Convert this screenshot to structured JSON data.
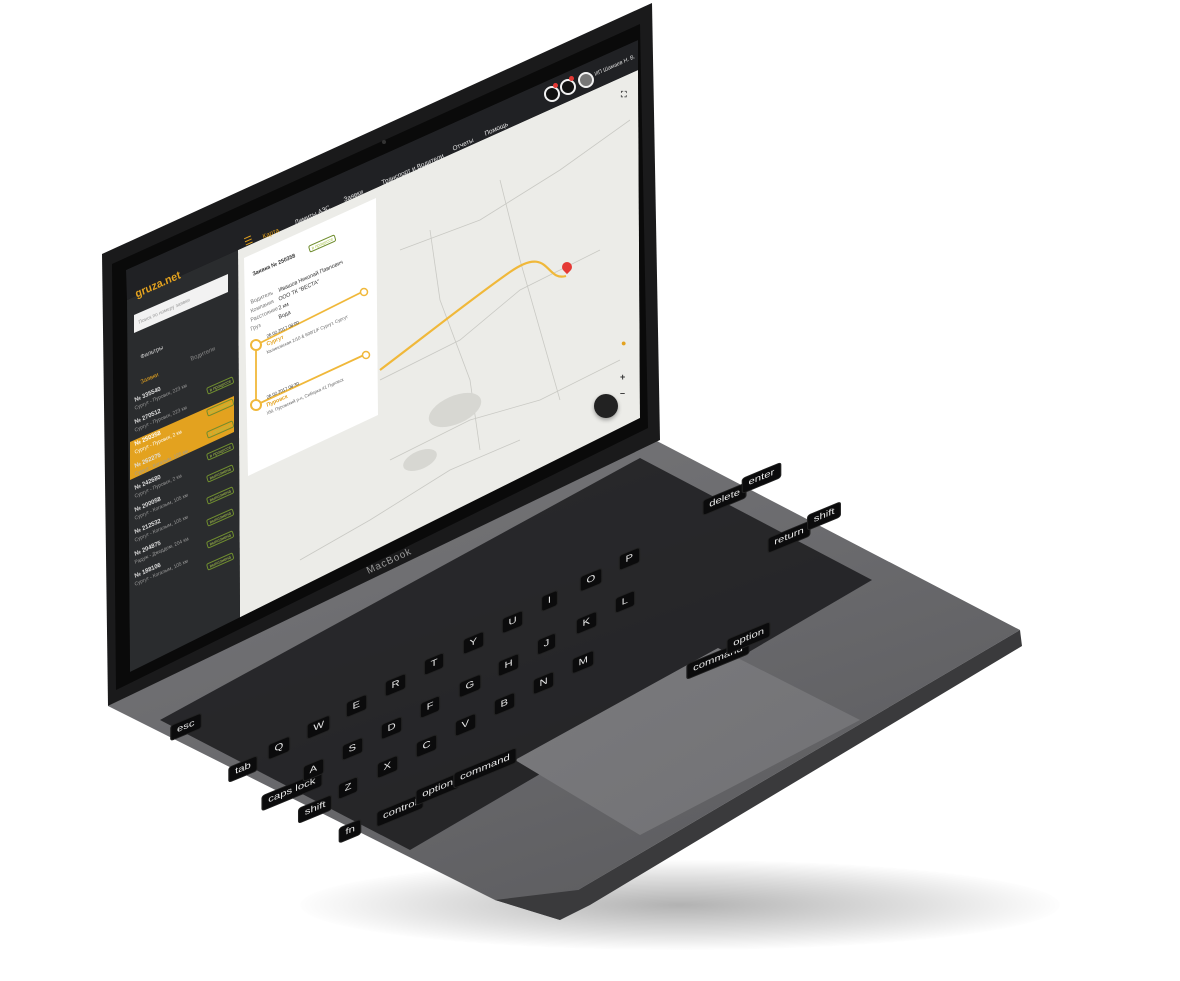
{
  "app": {
    "logo": "gruza.net",
    "device_brand": "MacBook"
  },
  "nav": {
    "items": [
      {
        "label": "Карта",
        "active": true
      },
      {
        "label": "Лимиты АЗС"
      },
      {
        "label": "Заявки"
      },
      {
        "label": "Транспорт и Водители"
      },
      {
        "label": "Отчеты"
      },
      {
        "label": "Помощь"
      }
    ],
    "user": "ИП Шамаев Н. В."
  },
  "sidebar": {
    "search_placeholder": "Поиск по номеру заявки",
    "filter_label": "Фильтры",
    "tabs": [
      {
        "label": "Заявки",
        "active": true
      },
      {
        "label": "Водители"
      }
    ],
    "orders": [
      {
        "number": "№ 335540",
        "route": "Сургут - Пуровск, 223 км",
        "status": "в процессе",
        "active": false
      },
      {
        "number": "№ 270512",
        "route": "Сургут - Пуровск, 223 км",
        "status": "выполнена",
        "active": false
      },
      {
        "number": "№ 250358",
        "route": "Сургут - Пуровск, 2 км",
        "status": "в процессе",
        "active": true
      },
      {
        "number": "№ 262275",
        "route": "Сургут - Когалым, 105 км",
        "status": "в процессе",
        "active": false
      },
      {
        "number": "№ 242680",
        "route": "Сургут - Пуровск, 2 км",
        "status": "выполнена",
        "active": false
      },
      {
        "number": "№ 200058",
        "route": "Сургут - Когалым, 105 км",
        "status": "выполнена",
        "active": false
      },
      {
        "number": "№ 212532",
        "route": "Сургут - Когалым, 105 км",
        "status": "выполнена",
        "active": false
      },
      {
        "number": "№ 204875",
        "route": "Радуж - Джеддем, 204 км",
        "status": "выполнена",
        "active": false
      },
      {
        "number": "№ 188106",
        "route": "Сургут - Когалым, 105 км",
        "status": "выполнена",
        "active": false
      }
    ]
  },
  "panel": {
    "title": "Заявка № 250358",
    "status": "в процессе",
    "fields": [
      {
        "label": "Водитель",
        "value": "Ивашов Николай Павлович"
      },
      {
        "label": "Компания",
        "value": "ООО ТК \"ВЕСТА\""
      },
      {
        "label": "Расстояние",
        "value": "2 км"
      },
      {
        "label": "Груз",
        "value": "Вода"
      }
    ],
    "stops": [
      {
        "datetime": "26.02.2017 08:00",
        "city": "Сургут",
        "address": "Калиновская 2/10 & 600/1/F Сургут, Сургут"
      },
      {
        "datetime": "26.02.2017 08:30",
        "city": "Пуровск",
        "address": "ХМ, Пуровский р-н, Сибирка 41 Пуровск"
      }
    ]
  },
  "colors": {
    "accent": "#e3a21f",
    "topbar": "#202124",
    "sidebar": "#2a2c2e",
    "map": "#ecece8",
    "route": "#f0b83a"
  },
  "keyboard": {
    "keys": [
      "esc",
      "tab",
      "caps lock",
      "shift",
      "fn",
      "control",
      "option",
      "command",
      "Q",
      "W",
      "E",
      "R",
      "T",
      "Y",
      "U",
      "I",
      "O",
      "P",
      "A",
      "S",
      "D",
      "F",
      "G",
      "H",
      "J",
      "K",
      "L",
      "Z",
      "X",
      "C",
      "V",
      "B",
      "N",
      "M",
      "command",
      "option",
      "return",
      "shift",
      "delete",
      "enter"
    ]
  }
}
